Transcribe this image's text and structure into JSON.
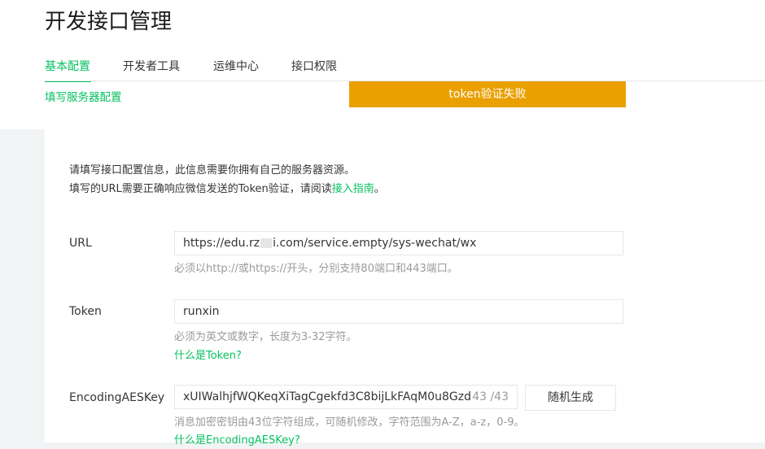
{
  "page_title": "开发接口管理",
  "tabs": [
    {
      "label": "基本配置",
      "active": true
    },
    {
      "label": "开发者工具",
      "active": false
    },
    {
      "label": "运维中心",
      "active": false
    },
    {
      "label": "接口权限",
      "active": false
    }
  ],
  "sub_link": "填写服务器配置",
  "toast": "token验证失败",
  "description": {
    "line1": "请填写接口配置信息，此信息需要你拥有自己的服务器资源。",
    "line2_prefix": "填写的URL需要正确响应微信发送的Token验证，请阅读",
    "line2_link": "接入指南",
    "line2_suffix": "。"
  },
  "form": {
    "url": {
      "label": "URL",
      "value_prefix": "https://edu.rz",
      "value_suffix": "i.com/service.empty/sys-wechat/wx",
      "hint": "必须以http://或https://开头，分别支持80端口和443端口。"
    },
    "token": {
      "label": "Token",
      "value": "runxin",
      "hint": "必须为英文或数字，长度为3-32字符。",
      "help_link": "什么是Token?"
    },
    "aes": {
      "label": "EncodingAESKey",
      "value": "xUIWalhjfWQKeqXiTagCgekfd3C8bijLkFAqM0u8Gzd",
      "counter": "43 /43",
      "generate_button": "随机生成",
      "hint": "消息加密密钥由43位字符组成，可随机修改，字符范围为A-Z，a-z，0-9。",
      "help_link": "什么是EncodingAESKey?"
    }
  },
  "colors": {
    "accent": "#07c160",
    "toast_bg": "#eaa000",
    "page_bg": "#f2f3f5"
  }
}
